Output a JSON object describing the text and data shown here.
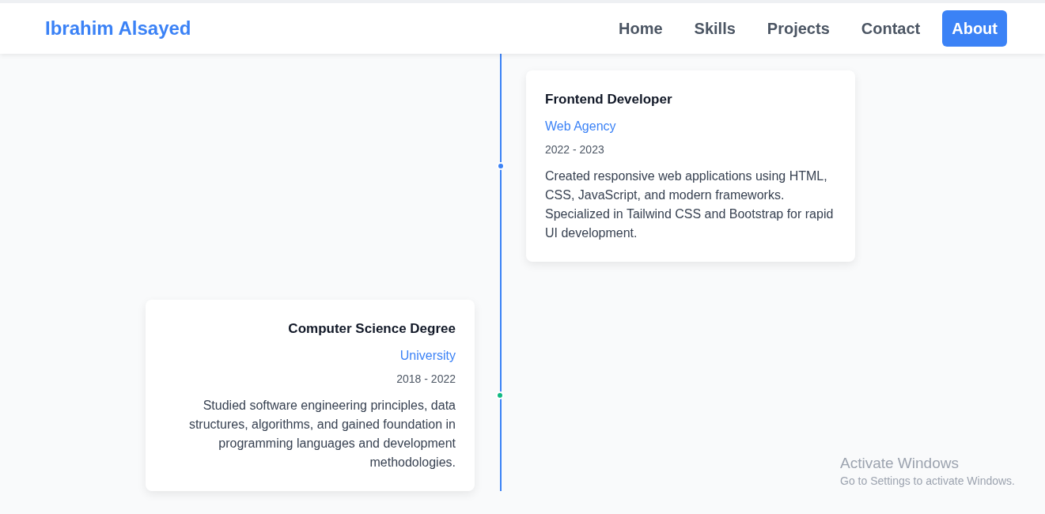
{
  "nav": {
    "logo": "Ibrahim Alsayed",
    "links": [
      {
        "label": "Home",
        "selected": false
      },
      {
        "label": "Skills",
        "selected": false
      },
      {
        "label": "Projects",
        "selected": false
      },
      {
        "label": "Contact",
        "selected": false
      },
      {
        "label": "About",
        "selected": true
      }
    ]
  },
  "timeline": [
    {
      "kind": "right",
      "title": "Frontend Developer",
      "org": "Web Agency",
      "dates": "2022 - 2023",
      "description": "Created responsive web applications using HTML, CSS, JavaScript, and modern frameworks. Specialized in Tailwind CSS and Bootstrap for rapid UI development.",
      "color": "#3b82f6"
    },
    {
      "kind": "left",
      "title": "Computer Science Degree",
      "org": "University",
      "dates": "2018 - 2022",
      "description": "Studied software engineering principles, data structures, algorithms, and gained foundation in programming languages and development methodologies.",
      "color": "#10b981"
    }
  ],
  "os_notice": {
    "title": "Activate Windows",
    "subtitle": "Go to Settings to activate Windows."
  }
}
